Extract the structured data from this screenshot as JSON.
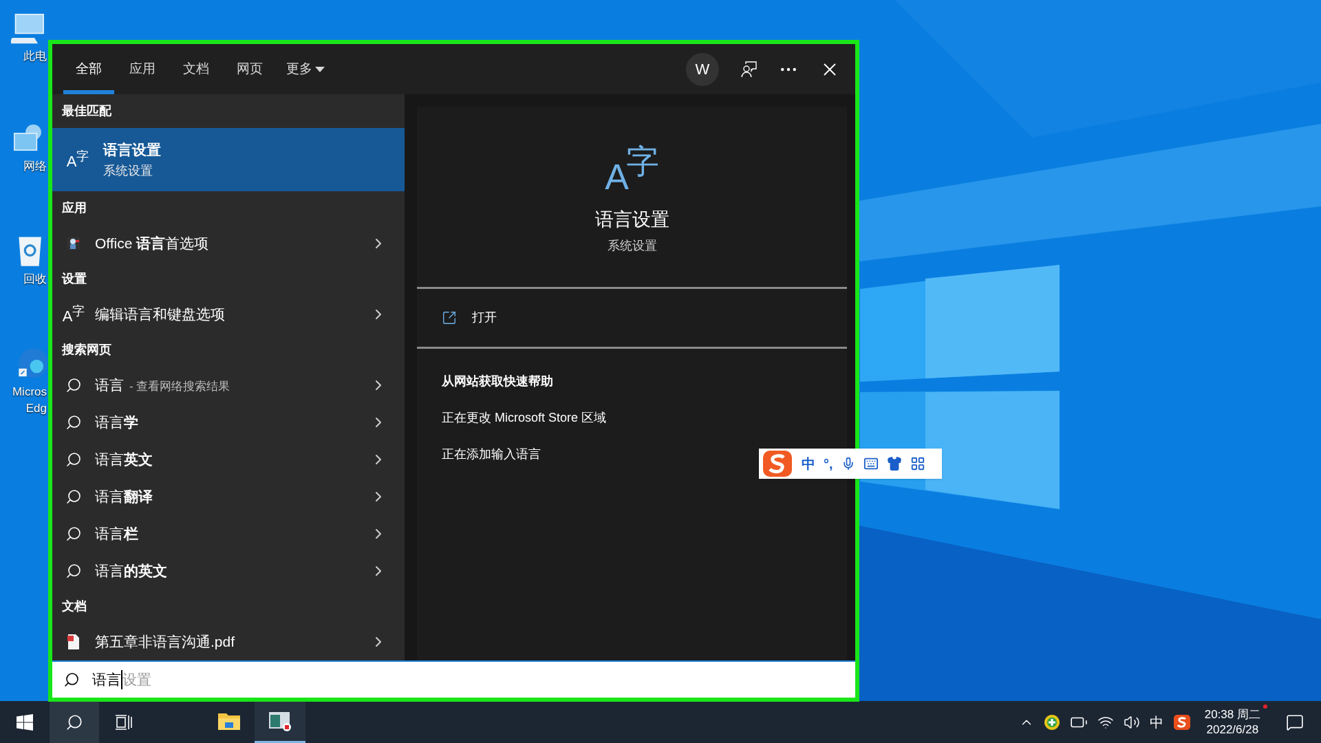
{
  "desktop_icons": [
    {
      "kind": "computer",
      "lines": [
        "此电"
      ]
    },
    {
      "kind": "network",
      "lines": [
        "网络"
      ]
    },
    {
      "kind": "recycle",
      "lines": [
        "回收"
      ]
    },
    {
      "kind": "edge",
      "lines": [
        "Micros",
        "Edg"
      ]
    }
  ],
  "search_window": {
    "tabs": [
      {
        "label": "全部",
        "selected": true
      },
      {
        "label": "应用",
        "selected": false
      },
      {
        "label": "文档",
        "selected": false
      },
      {
        "label": "网页",
        "selected": false
      }
    ],
    "more_tab": "更多",
    "avatar": "W",
    "sections": [
      {
        "heading": "最佳匹配",
        "items": [
          {
            "kind": "best",
            "glyphs": [
              "A",
              "字"
            ],
            "title": "语言设置",
            "subtitle": "系统设置",
            "selected": true
          }
        ]
      },
      {
        "heading": "应用",
        "items": [
          {
            "kind": "app",
            "title": "Office **语言**首选项",
            "selected": false
          }
        ]
      },
      {
        "heading": "设置",
        "items": [
          {
            "kind": "setting",
            "glyphs": [
              "A",
              "字"
            ],
            "title": "编辑语言和键盘选项",
            "selected": false
          }
        ]
      },
      {
        "heading": "搜索网页",
        "items": [
          {
            "kind": "web",
            "title": "语言",
            "note": "- 查看网络搜索结果",
            "selected": false
          },
          {
            "kind": "web",
            "title": "语言**学**",
            "selected": false
          },
          {
            "kind": "web",
            "title": "语言**英文**",
            "selected": false
          },
          {
            "kind": "web",
            "title": "语言**翻译**",
            "selected": false
          },
          {
            "kind": "web",
            "title": "语言**栏**",
            "selected": false
          },
          {
            "kind": "web",
            "title": "语言**的英文**",
            "selected": false
          }
        ]
      },
      {
        "heading": "文档",
        "items": [
          {
            "kind": "document",
            "title": "第五章非语言沟通.pdf",
            "selected": false
          }
        ]
      }
    ],
    "preview": {
      "glyphs": [
        "A",
        "字"
      ],
      "title": "语言设置",
      "subtitle": "系统设置",
      "action": "打开",
      "help_heading": "从网站获取快速帮助",
      "help_links": [
        "正在更改 Microsoft Store 区域",
        "正在添加输入语言"
      ]
    },
    "search_box": {
      "value": "语言",
      "suggestion": "设置"
    }
  },
  "ime_toolbar": {
    "mode": "中",
    "punctuation": "°,"
  },
  "taskbar": {
    "apps": [
      {
        "kind": "explorer",
        "active": false
      },
      {
        "kind": "app",
        "active": true
      }
    ],
    "tray": {
      "ime": "中",
      "time": "20:38 周二",
      "date": "2022/6/28"
    }
  }
}
